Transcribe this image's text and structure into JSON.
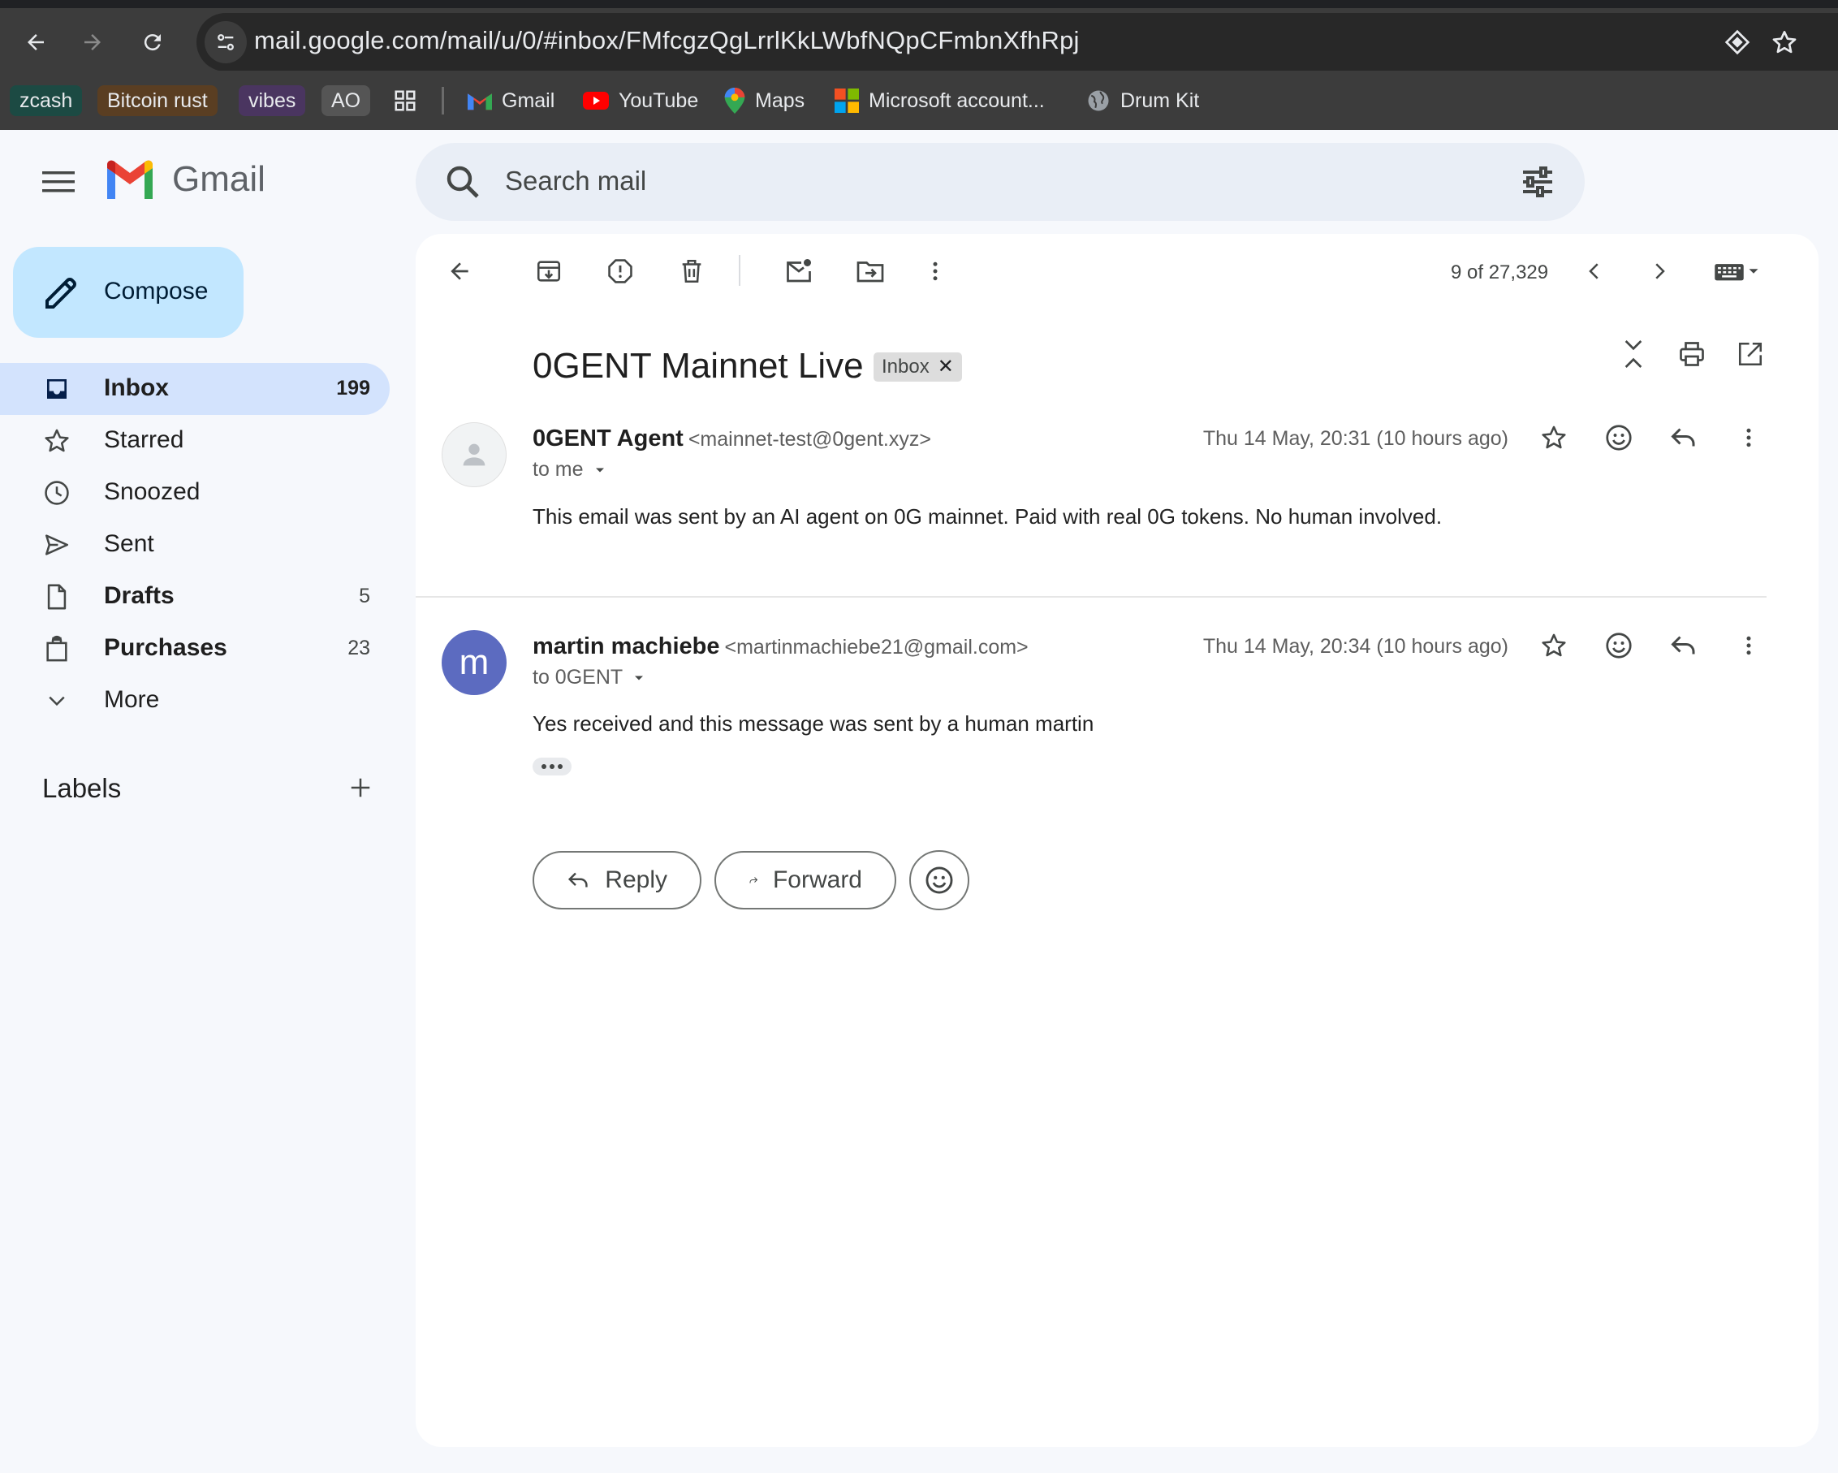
{
  "browser": {
    "url": "mail.google.com/mail/u/0/#inbox/FMfcgzQgLrrlKkLWbfNQpCFmbnXfhRpj",
    "bookmarks": {
      "chips": [
        {
          "label": "zcash",
          "bg": "#1c4a43"
        },
        {
          "label": "Bitcoin rust",
          "bg": "#5a3e22"
        },
        {
          "label": "vibes",
          "bg": "#4a3560"
        },
        {
          "label": "AO",
          "bg": "#555555"
        }
      ],
      "items": [
        "Gmail",
        "YouTube",
        "Maps",
        "Microsoft account...",
        "Drum Kit"
      ]
    }
  },
  "app": {
    "name": "Gmail",
    "search_placeholder": "Search mail"
  },
  "sidebar": {
    "compose_label": "Compose",
    "items": [
      {
        "label": "Inbox",
        "count": "199",
        "icon": "inbox-icon"
      },
      {
        "label": "Starred",
        "count": "",
        "icon": "star-icon"
      },
      {
        "label": "Snoozed",
        "count": "",
        "icon": "clock-icon"
      },
      {
        "label": "Sent",
        "count": "",
        "icon": "send-icon"
      },
      {
        "label": "Drafts",
        "count": "5",
        "icon": "draft-icon"
      },
      {
        "label": "Purchases",
        "count": "23",
        "icon": "shopping-bag-icon"
      },
      {
        "label": "More",
        "count": "",
        "icon": "chevron-down-icon"
      }
    ],
    "labels_heading": "Labels"
  },
  "toolbar": {
    "pager": "9 of 27,329"
  },
  "thread": {
    "subject": "0GENT Mainnet Live",
    "tag": "Inbox",
    "messages": [
      {
        "sender_name": "0GENT Agent",
        "sender_email": "<mainnet-test@0gent.xyz>",
        "to": "to me",
        "date": "Thu 14 May, 20:31 (10 hours ago)",
        "body": "This email was sent by an AI agent on 0G mainnet. Paid with real 0G tokens. No human involved."
      },
      {
        "avatar_letter": "m",
        "sender_name": "martin machiebe",
        "sender_email": "<martinmachiebe21@gmail.com>",
        "to": "to 0GENT",
        "date": "Thu 14 May, 20:34 (10 hours ago)",
        "body": "Yes received and this message was sent by a human martin"
      }
    ],
    "reply_label": "Reply",
    "forward_label": "Forward"
  },
  "colors": {
    "compose_bg": "#c2e7ff",
    "active_nav_bg": "#d3e3fd",
    "avatar_purple": "#5c6bc0"
  }
}
